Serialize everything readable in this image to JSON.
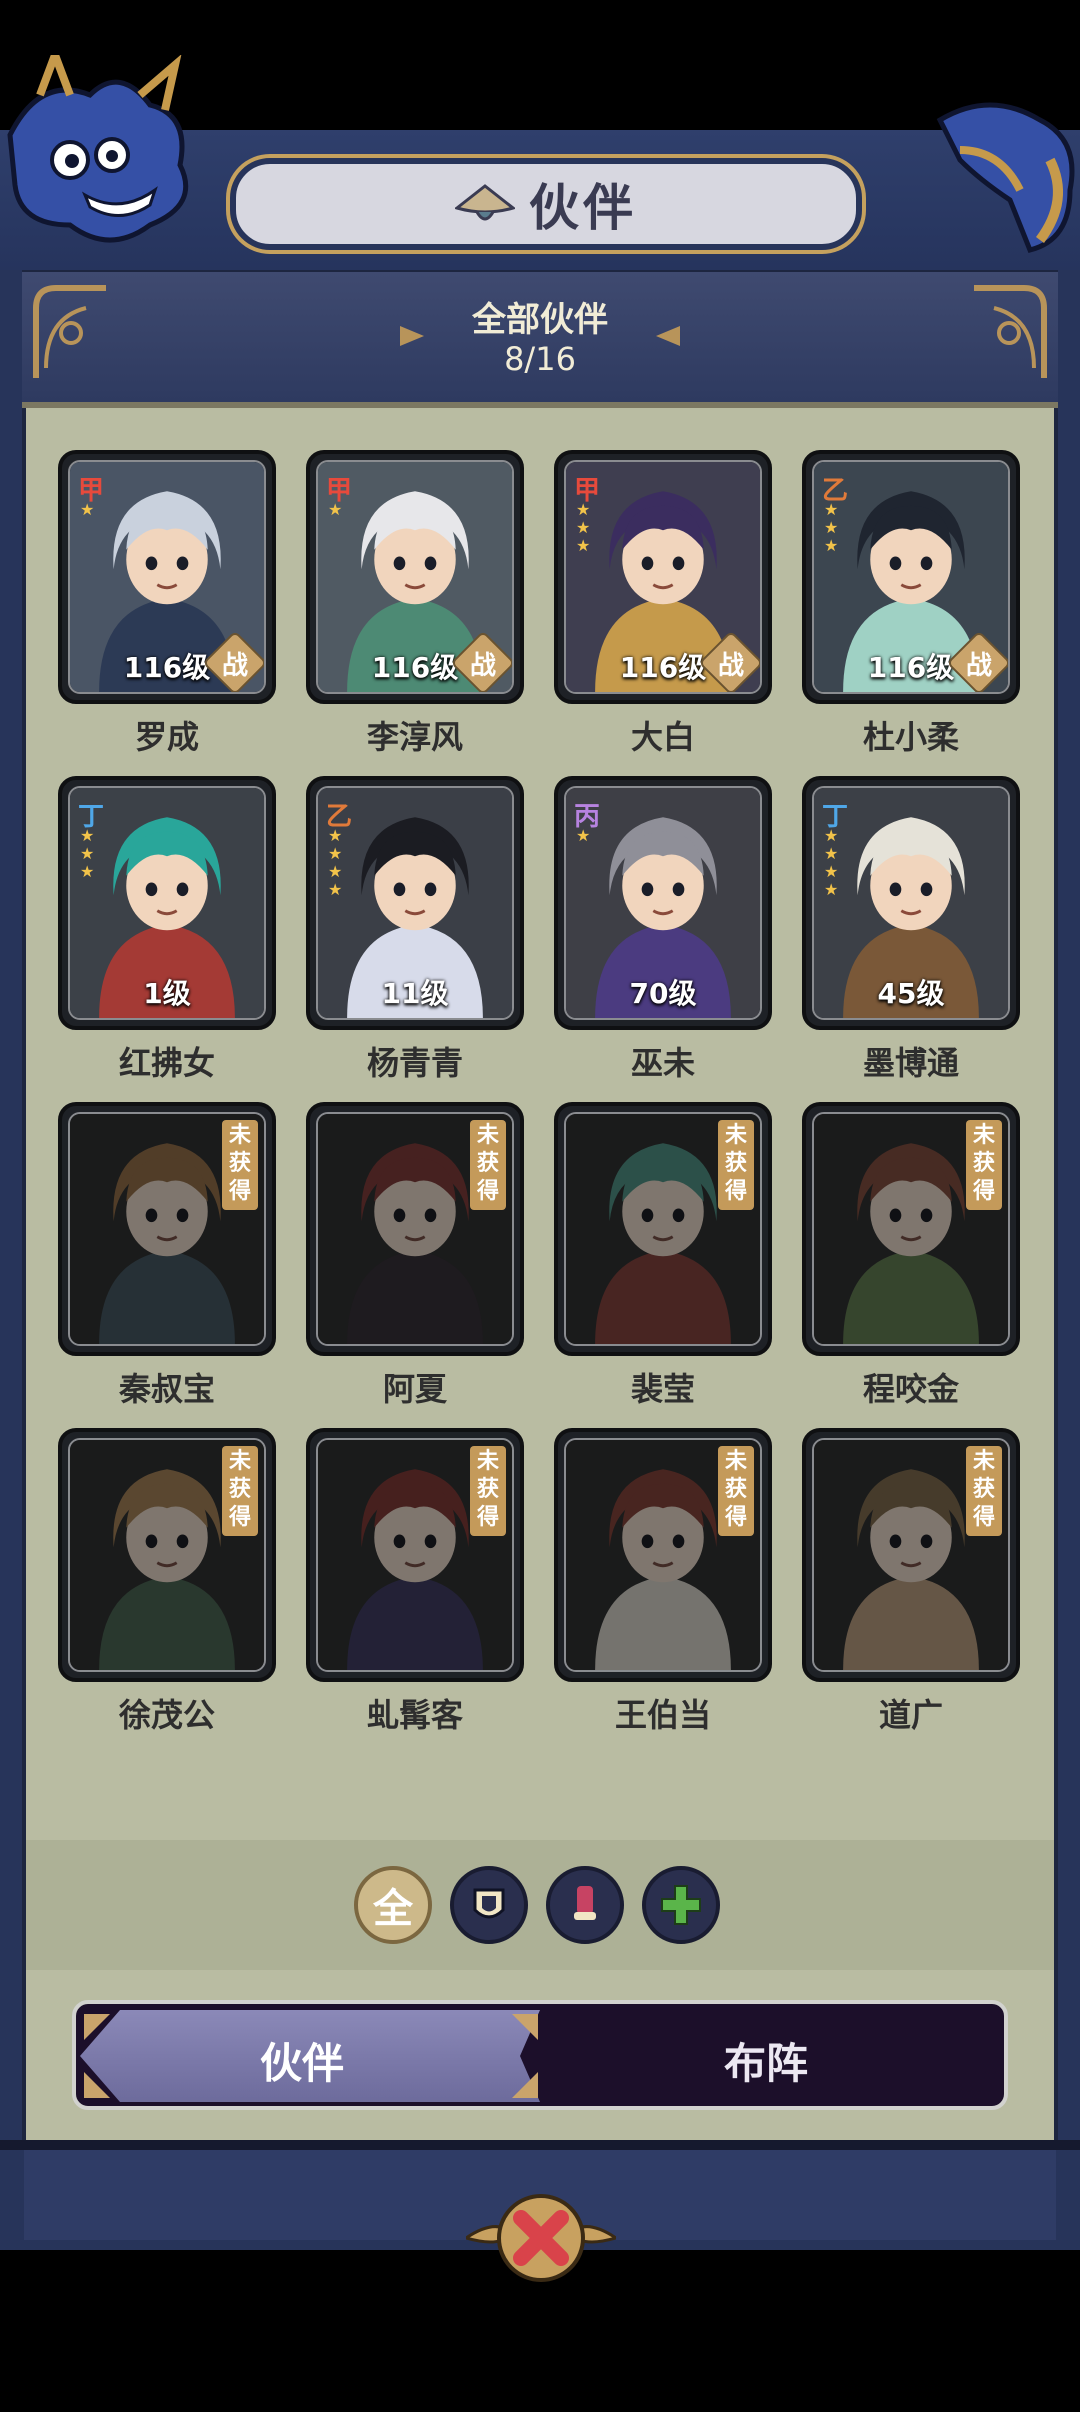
{
  "header": {
    "title": "伙伴"
  },
  "banner": {
    "title": "全部伙伴",
    "count": "8/16"
  },
  "partners": [
    {
      "name": "罗成",
      "grade": "甲",
      "grade_color": "#e74a3c",
      "stars": 1,
      "level": "116级",
      "battle": "战",
      "owned": true,
      "palette": [
        "#4a5565",
        "#c9d1dd",
        "#2c3a55"
      ]
    },
    {
      "name": "李淳风",
      "grade": "甲",
      "grade_color": "#e74a3c",
      "stars": 1,
      "level": "116级",
      "battle": "战",
      "owned": true,
      "palette": [
        "#505a63",
        "#e7e7ea",
        "#4d8a74"
      ]
    },
    {
      "name": "大白",
      "grade": "甲",
      "grade_color": "#e74a3c",
      "stars": 3,
      "level": "116级",
      "battle": "战",
      "owned": true,
      "palette": [
        "#3f3e50",
        "#3b2d5f",
        "#c59a4b"
      ]
    },
    {
      "name": "杜小柔",
      "grade": "乙",
      "grade_color": "#e07a3a",
      "stars": 3,
      "level": "116级",
      "battle": "战",
      "owned": true,
      "palette": [
        "#3c4650",
        "#1f2530",
        "#9fd1c4"
      ]
    },
    {
      "name": "红拂女",
      "grade": "丁",
      "grade_color": "#4fa7e8",
      "stars": 3,
      "level": "1级",
      "battle": "",
      "owned": true,
      "palette": [
        "#3c4148",
        "#29a69a",
        "#a43a35"
      ]
    },
    {
      "name": "杨青青",
      "grade": "乙",
      "grade_color": "#e07a3a",
      "stars": 4,
      "level": "11级",
      "battle": "",
      "owned": true,
      "palette": [
        "#3b3f47",
        "#1b1c22",
        "#d7dbea"
      ]
    },
    {
      "name": "巫未",
      "grade": "丙",
      "grade_color": "#b783e0",
      "stars": 1,
      "level": "70级",
      "battle": "",
      "owned": true,
      "palette": [
        "#3e3f46",
        "#8f8f98",
        "#4b3b80"
      ]
    },
    {
      "name": "墨博通",
      "grade": "丁",
      "grade_color": "#4fa7e8",
      "stars": 4,
      "level": "45级",
      "battle": "",
      "owned": true,
      "palette": [
        "#3c4047",
        "#e5e2d8",
        "#7a5838"
      ]
    },
    {
      "name": "秦叔宝",
      "owned": false,
      "locked_tag": "未获得",
      "palette": [
        "#2f3132",
        "#a86b2c",
        "#3a5a6a"
      ]
    },
    {
      "name": "阿夏",
      "owned": false,
      "locked_tag": "未获得",
      "palette": [
        "#2f3132",
        "#a3322f",
        "#3a2f3b"
      ]
    },
    {
      "name": "裴莹",
      "owned": false,
      "locked_tag": "未获得",
      "palette": [
        "#2f3132",
        "#2f9c85",
        "#a53a33"
      ]
    },
    {
      "name": "程咬金",
      "owned": false,
      "locked_tag": "未获得",
      "palette": [
        "#2f3132",
        "#9e4730",
        "#57843b"
      ]
    },
    {
      "name": "徐茂公",
      "owned": false,
      "locked_tag": "未获得",
      "palette": [
        "#2f3132",
        "#b77e3a",
        "#3d6a4c"
      ]
    },
    {
      "name": "虬髯客",
      "owned": false,
      "locked_tag": "未获得",
      "palette": [
        "#2f3132",
        "#a4302b",
        "#3f3a7a"
      ]
    },
    {
      "name": "王伯当",
      "owned": false,
      "locked_tag": "未获得",
      "palette": [
        "#2f3132",
        "#a63a2c",
        "#d7d1c2"
      ]
    },
    {
      "name": "道广",
      "owned": false,
      "locked_tag": "未获得",
      "palette": [
        "#2f3132",
        "#8a6a3a",
        "#c89a6a"
      ]
    }
  ],
  "filters": [
    {
      "id": "all",
      "label": "全",
      "icon": "all-icon",
      "active": true
    },
    {
      "id": "defense",
      "label": "",
      "icon": "shield-icon",
      "active": false
    },
    {
      "id": "attack",
      "label": "",
      "icon": "scroll-icon",
      "active": false
    },
    {
      "id": "support",
      "label": "",
      "icon": "plus-icon",
      "active": false
    }
  ],
  "tabs": [
    {
      "label": "伙伴",
      "active": true
    },
    {
      "label": "布阵",
      "active": false
    }
  ],
  "colors": {
    "accent_gold": "#c8a160",
    "frame_navy": "#27345a",
    "panel": "#b9bca2"
  }
}
